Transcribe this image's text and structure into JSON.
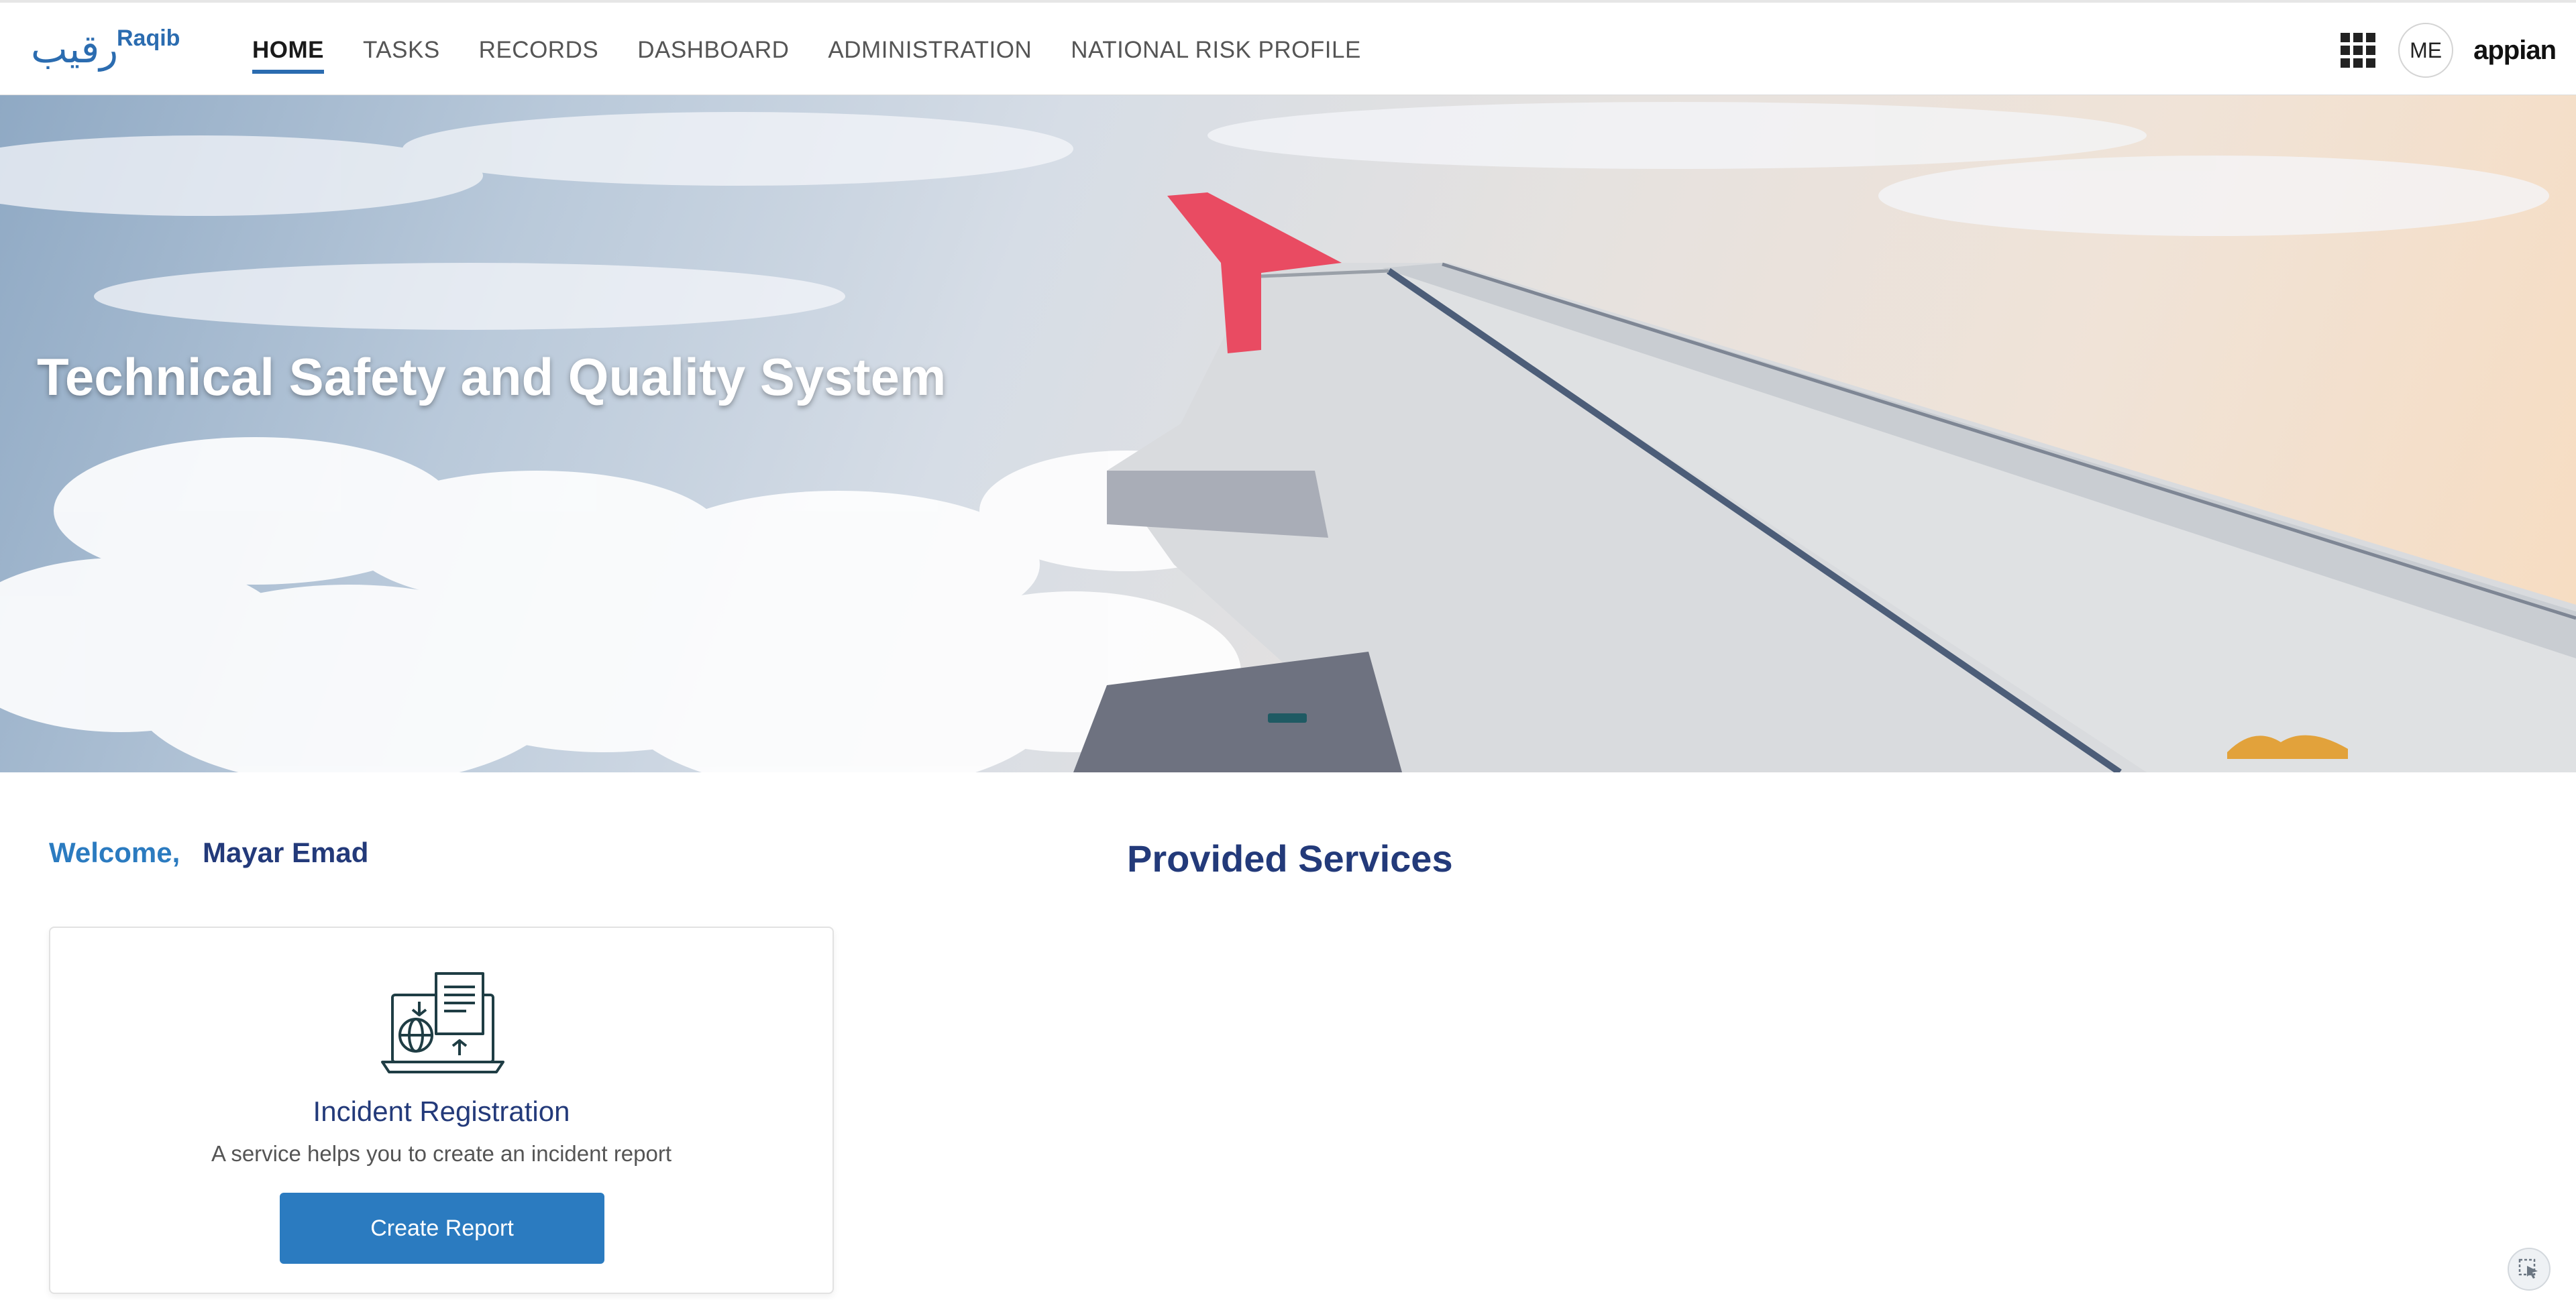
{
  "header": {
    "logo_ar": "رقيب",
    "logo_en": "Raqib",
    "tabs": [
      {
        "label": "HOME",
        "active": true
      },
      {
        "label": "TASKS"
      },
      {
        "label": "RECORDS"
      },
      {
        "label": "DASHBOARD"
      },
      {
        "label": "ADMINISTRATION"
      },
      {
        "label": "NATIONAL RISK PROFILE"
      }
    ],
    "apps_icon": "grid-apps-icon",
    "avatar_initials": "ME",
    "brand": "appian"
  },
  "hero": {
    "title": "Technical Safety and Quality System",
    "carousel_active_index": 0
  },
  "welcome": {
    "greeting": "Welcome,",
    "user_name": "Mayar Emad"
  },
  "services": {
    "title": "Provided Services",
    "cards": [
      {
        "icon": "laptop-globe-document-icon",
        "title": "Incident Registration",
        "description": "A service  helps you to create an incident report",
        "button_label": "Create Report"
      }
    ]
  },
  "colors": {
    "primary": "#2b7bc0",
    "heading": "#233a7a",
    "wing_tip": "#e94b62"
  },
  "corner_button_icon": "cursor-select-icon"
}
